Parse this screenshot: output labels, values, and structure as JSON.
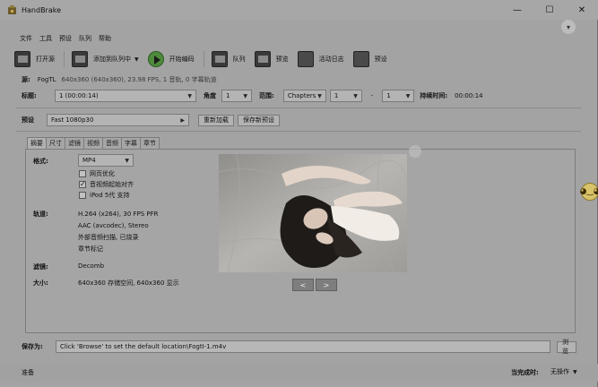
{
  "window": {
    "title": "HandBrake",
    "minimize": "—",
    "maximize": "☐",
    "close": "✕"
  },
  "menu": [
    "文件",
    "工具",
    "预设",
    "队列",
    "帮助"
  ],
  "toolbar": {
    "open_source": "打开源",
    "add_to_queue": "添加到队列中",
    "start_encode": "开始编码",
    "queue": "队列",
    "preview": "预览",
    "activity_log": "活动日志",
    "presets": "预设"
  },
  "source": {
    "label": "源:",
    "name": "FogTL",
    "details": "640x360 (640x360), 23.98 FPS, 1 音轨, 0 字幕轨道"
  },
  "title_row": {
    "title_label": "标题:",
    "title_value": "1 (00:00:14)",
    "angle_label": "角度",
    "angle_value": "1",
    "range_label": "范围:",
    "range_mode": "Chapters",
    "range_start": "1",
    "range_dash": "-",
    "range_end": "1",
    "duration_label": "持续时间:",
    "duration_value": "00:00:14"
  },
  "preset_row": {
    "label": "预设",
    "value": "Fast 1080p30",
    "reload_button": "重新加载",
    "save_new_button": "保存新预设"
  },
  "tabs": [
    "摘要",
    "尺寸",
    "滤镜",
    "视频",
    "音频",
    "字幕",
    "章节"
  ],
  "summary": {
    "format_label": "格式:",
    "format_value": "MP4",
    "web_optimized": "网页优化",
    "align_av": "音视频起始对齐",
    "ipod_support": "iPod 5代 支持",
    "tracks_label": "轨道:",
    "tracks": [
      "H.264 (x264), 30 FPS PFR",
      "AAC (avcodec), Stereo",
      "外部音频扫描, 已烧录",
      "章节标记"
    ],
    "filters_label": "滤镜:",
    "filters_value": "Decomb",
    "size_label": "大小:",
    "size_value": "640x360 存储空间, 640x360 显示",
    "prev_button": "<",
    "next_button": ">"
  },
  "save_row": {
    "label": "保存为:",
    "path": "Click 'Browse' to set the default location\\FogtI-1.m4v",
    "browse_button": "浏览"
  },
  "status": {
    "left": "准备",
    "when_done_label": "当完成时:",
    "when_done_value": "无操作"
  }
}
